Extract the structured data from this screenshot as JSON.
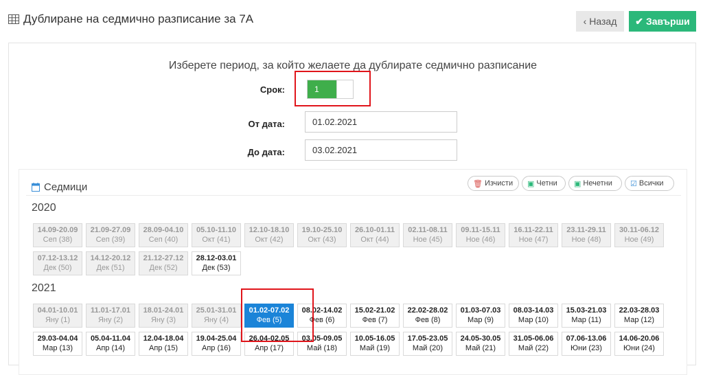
{
  "header": {
    "title": "Дублиране на седмично разписание за 7А",
    "back_label": "Назад",
    "finish_label": "Завърши"
  },
  "form": {
    "prompt": "Изберете период, за който желаете да дублирате седмично разписание",
    "term_label": "Срок:",
    "term_value": "1",
    "from_label": "От дата:",
    "from_value": "01.02.2021",
    "to_label": "До дата:",
    "to_value": "03.02.2021"
  },
  "weeks_panel": {
    "title": "Седмици",
    "clear_label": "Изчисти",
    "even_label": "Четни",
    "odd_label": "Нечетни",
    "all_label": "Всички"
  },
  "years": [
    {
      "year": "2020",
      "weeks": [
        {
          "range": "14.09-20.09",
          "month": "Сеп (38)",
          "state": "past"
        },
        {
          "range": "21.09-27.09",
          "month": "Сеп (39)",
          "state": "past"
        },
        {
          "range": "28.09-04.10",
          "month": "Сеп (40)",
          "state": "past"
        },
        {
          "range": "05.10-11.10",
          "month": "Окт (41)",
          "state": "past"
        },
        {
          "range": "12.10-18.10",
          "month": "Окт (42)",
          "state": "past"
        },
        {
          "range": "19.10-25.10",
          "month": "Окт (43)",
          "state": "past"
        },
        {
          "range": "26.10-01.11",
          "month": "Окт (44)",
          "state": "past"
        },
        {
          "range": "02.11-08.11",
          "month": "Ное (45)",
          "state": "past"
        },
        {
          "range": "09.11-15.11",
          "month": "Ное (46)",
          "state": "past"
        },
        {
          "range": "16.11-22.11",
          "month": "Ное (47)",
          "state": "past"
        },
        {
          "range": "23.11-29.11",
          "month": "Ное (48)",
          "state": "past"
        },
        {
          "range": "30.11-06.12",
          "month": "Ное (49)",
          "state": "past"
        },
        {
          "range": "07.12-13.12",
          "month": "Дек (50)",
          "state": "past"
        },
        {
          "range": "14.12-20.12",
          "month": "Дек (51)",
          "state": "past"
        },
        {
          "range": "21.12-27.12",
          "month": "Дек (52)",
          "state": "past"
        },
        {
          "range": "28.12-03.01",
          "month": "Дек (53)",
          "state": "upcoming"
        }
      ]
    },
    {
      "year": "2021",
      "weeks": [
        {
          "range": "04.01-10.01",
          "month": "Яну (1)",
          "state": "past"
        },
        {
          "range": "11.01-17.01",
          "month": "Яну (2)",
          "state": "past"
        },
        {
          "range": "18.01-24.01",
          "month": "Яну (3)",
          "state": "past"
        },
        {
          "range": "25.01-31.01",
          "month": "Яну (4)",
          "state": "past"
        },
        {
          "range": "01.02-07.02",
          "month": "Фев (5)",
          "state": "selected"
        },
        {
          "range": "08.02-14.02",
          "month": "Фев (6)",
          "state": "upcoming"
        },
        {
          "range": "15.02-21.02",
          "month": "Фев (7)",
          "state": "upcoming"
        },
        {
          "range": "22.02-28.02",
          "month": "Фев (8)",
          "state": "upcoming"
        },
        {
          "range": "01.03-07.03",
          "month": "Мар (9)",
          "state": "upcoming"
        },
        {
          "range": "08.03-14.03",
          "month": "Мар (10)",
          "state": "upcoming"
        },
        {
          "range": "15.03-21.03",
          "month": "Мар (11)",
          "state": "upcoming"
        },
        {
          "range": "22.03-28.03",
          "month": "Мар (12)",
          "state": "upcoming"
        },
        {
          "range": "29.03-04.04",
          "month": "Мар (13)",
          "state": "upcoming"
        },
        {
          "range": "05.04-11.04",
          "month": "Апр (14)",
          "state": "upcoming"
        },
        {
          "range": "12.04-18.04",
          "month": "Апр (15)",
          "state": "upcoming"
        },
        {
          "range": "19.04-25.04",
          "month": "Апр (16)",
          "state": "upcoming"
        },
        {
          "range": "26.04-02.05",
          "month": "Апр (17)",
          "state": "upcoming"
        },
        {
          "range": "03.05-09.05",
          "month": "Май (18)",
          "state": "upcoming"
        },
        {
          "range": "10.05-16.05",
          "month": "Май (19)",
          "state": "upcoming"
        },
        {
          "range": "17.05-23.05",
          "month": "Май (20)",
          "state": "upcoming"
        },
        {
          "range": "24.05-30.05",
          "month": "Май (21)",
          "state": "upcoming"
        },
        {
          "range": "31.05-06.06",
          "month": "Май (22)",
          "state": "upcoming"
        },
        {
          "range": "07.06-13.06",
          "month": "Юни (23)",
          "state": "upcoming"
        },
        {
          "range": "14.06-20.06",
          "month": "Юни (24)",
          "state": "upcoming"
        }
      ]
    }
  ],
  "colors": {
    "accent_green": "#2bb87a",
    "toggle_green": "#3fae4b",
    "selected_blue": "#1b84d8",
    "highlight_red": "#e0141a"
  },
  "icons": {
    "title": "table-grid-icon",
    "back": "chevron-left-icon",
    "finish": "check-icon",
    "weeks": "calendar-icon",
    "clear": "trash-icon",
    "even": "calendar-plus-icon",
    "odd": "calendar-minus-icon",
    "all": "calendar-check-icon"
  }
}
